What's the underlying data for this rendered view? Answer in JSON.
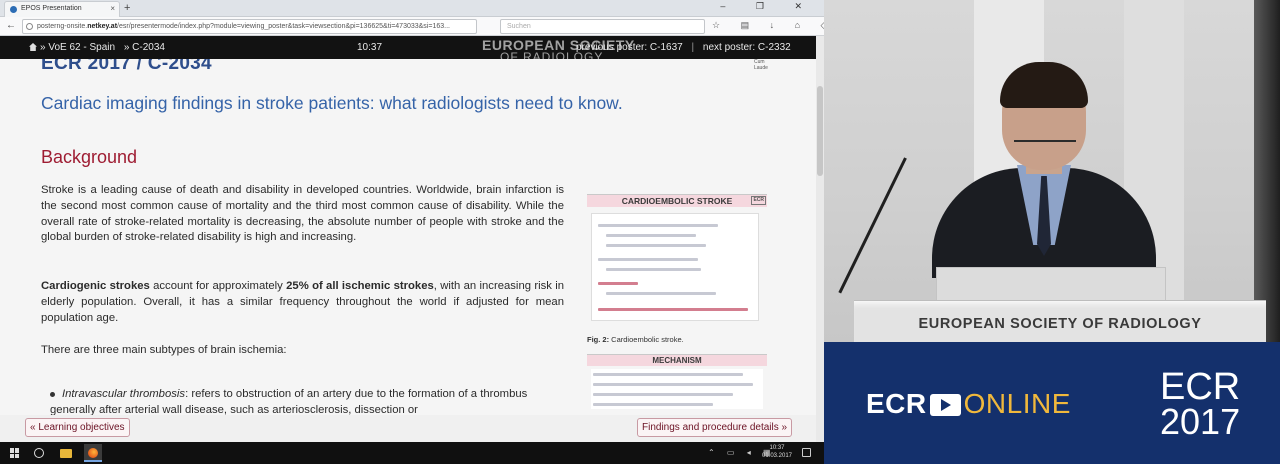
{
  "browser": {
    "tab_title": "EPOS Presentation",
    "url_prefix": "posterng-onsite.",
    "url_host": "netkey.at",
    "url_rest": "/esr/presentermode/index.php?module=viewing_poster&task=viewsection&pi=136625&ti=473033&si=163...",
    "search_placeholder": "Suchen"
  },
  "header": {
    "breadcrumb": [
      "» VoE 62 - Spain",
      "» C-2034"
    ],
    "time": "10:37",
    "watermark_line1": "EUROPEAN SOCIETY",
    "watermark_line2": "OF RADIOLOGY",
    "previous_poster": "previous poster: C-1637",
    "separator": "|",
    "next_poster": "next poster: C-2332"
  },
  "document": {
    "code": "ECR 2017 / C-2034",
    "logo_text": "Cum Laude",
    "title": "Cardiac imaging findings in stroke patients: what radiologists need to know.",
    "section": "Background",
    "paragraph1": "Stroke is a leading cause of death and disability in developed countries. Worldwide, brain infarction is the second most common cause of mortality and the third most common cause of disability. While the overall rate of stroke-related mortality is decreasing, the absolute number of people with stroke and the global burden of stroke-related disability is high and increasing.",
    "paragraph2_bold1": "Cardiogenic strokes",
    "paragraph2_mid": " account for approximately ",
    "paragraph2_bold2": "25% of all ischemic strokes",
    "paragraph2_end": ", with an increasing risk in elderly population. Overall, it has a similar frequency throughout the world if adjusted for mean population age.",
    "paragraph3": "There are three main subtypes of brain ischemia:",
    "bullet1_term": "Intravascular thrombosis",
    "bullet1_text": ": refers to obstruction of an artery due to the formation of a thrombus generally after arterial wall disease, such as arteriosclerosis, dissection or",
    "figure1_title": "CARDIOEMBOLIC STROKE",
    "figure_badge": "ECR",
    "figure1_caption_label": "Fig. 2:",
    "figure1_caption": " Cardioembolic stroke.",
    "figure2_title": "MECHANISM"
  },
  "bottom_nav": {
    "previous": "« Learning objectives",
    "next": "Findings and procedure details »"
  },
  "taskbar": {
    "tray_time": "10:37",
    "tray_date": "01.03.2017"
  },
  "stage": {
    "podium_text": "EUROPEAN SOCIETY OF RADIOLOGY"
  },
  "brand": {
    "ecr_word": "ECR",
    "online_word": "ONLINE",
    "ecr_logo": "ECR",
    "ecr_year": "2017"
  },
  "colors": {
    "title_blue": "#3563a8",
    "section_red": "#9e1c32",
    "brand_blue": "#14306c",
    "online_gold": "#f0b83c"
  }
}
